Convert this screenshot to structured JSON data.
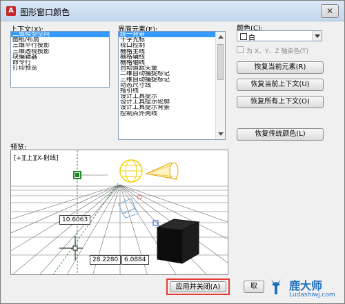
{
  "window": {
    "title": "图形窗口颜色",
    "close_glyph": "✕",
    "app_icon_glyph": "A"
  },
  "context": {
    "label": "上下文(X):",
    "items": [
      "二维模型空间",
      "图纸/布局",
      "三维平行投影",
      "三维透视投影",
      "块编辑器",
      "命令行",
      "打印预览"
    ],
    "selected_index": 0
  },
  "interface_elements": {
    "label": "界面元素(E):",
    "items": [
      "统一背景",
      "十字光标",
      "视口控制",
      "栅格主线",
      "栅格辅线",
      "栅格轴线",
      "自动追踪矢量",
      "二维自动捕捉标记",
      "三维自动捕捉标记",
      "动态尺寸线",
      "拖引线",
      "设计工具提示",
      "设计工具提示轮廓",
      "设计工具提示背景",
      "控制点外壳线"
    ],
    "selected_index": 0
  },
  "color": {
    "label": "颜色(C):",
    "selected_value": "白",
    "swatch_color": "#ffffff"
  },
  "tint": {
    "label": "为 X、Y、Z 轴染色(T)",
    "checked": false
  },
  "buttons": {
    "restore_current_element": "恢复当前元素(R)",
    "restore_current_context": "恢复当前上下文(U)",
    "restore_all_contexts": "恢复所有上下文(O)",
    "restore_classic_colors": "恢复传统颜色(L)",
    "apply_close": "应用并关闭(A)",
    "cancel": "取"
  },
  "preview": {
    "label": "预览:",
    "viewport_label": "[+][上][X-射线]",
    "dim_value_1": "10.6063",
    "dim_value_2": "28.2280",
    "dim_value_3": "6.0884"
  },
  "watermark": {
    "name": "鹿大师",
    "url": "Ludashiwj.com"
  },
  "colors": {
    "highlight": "#e53935",
    "selection": "#3399ff",
    "brand": "#1d6fbf"
  }
}
